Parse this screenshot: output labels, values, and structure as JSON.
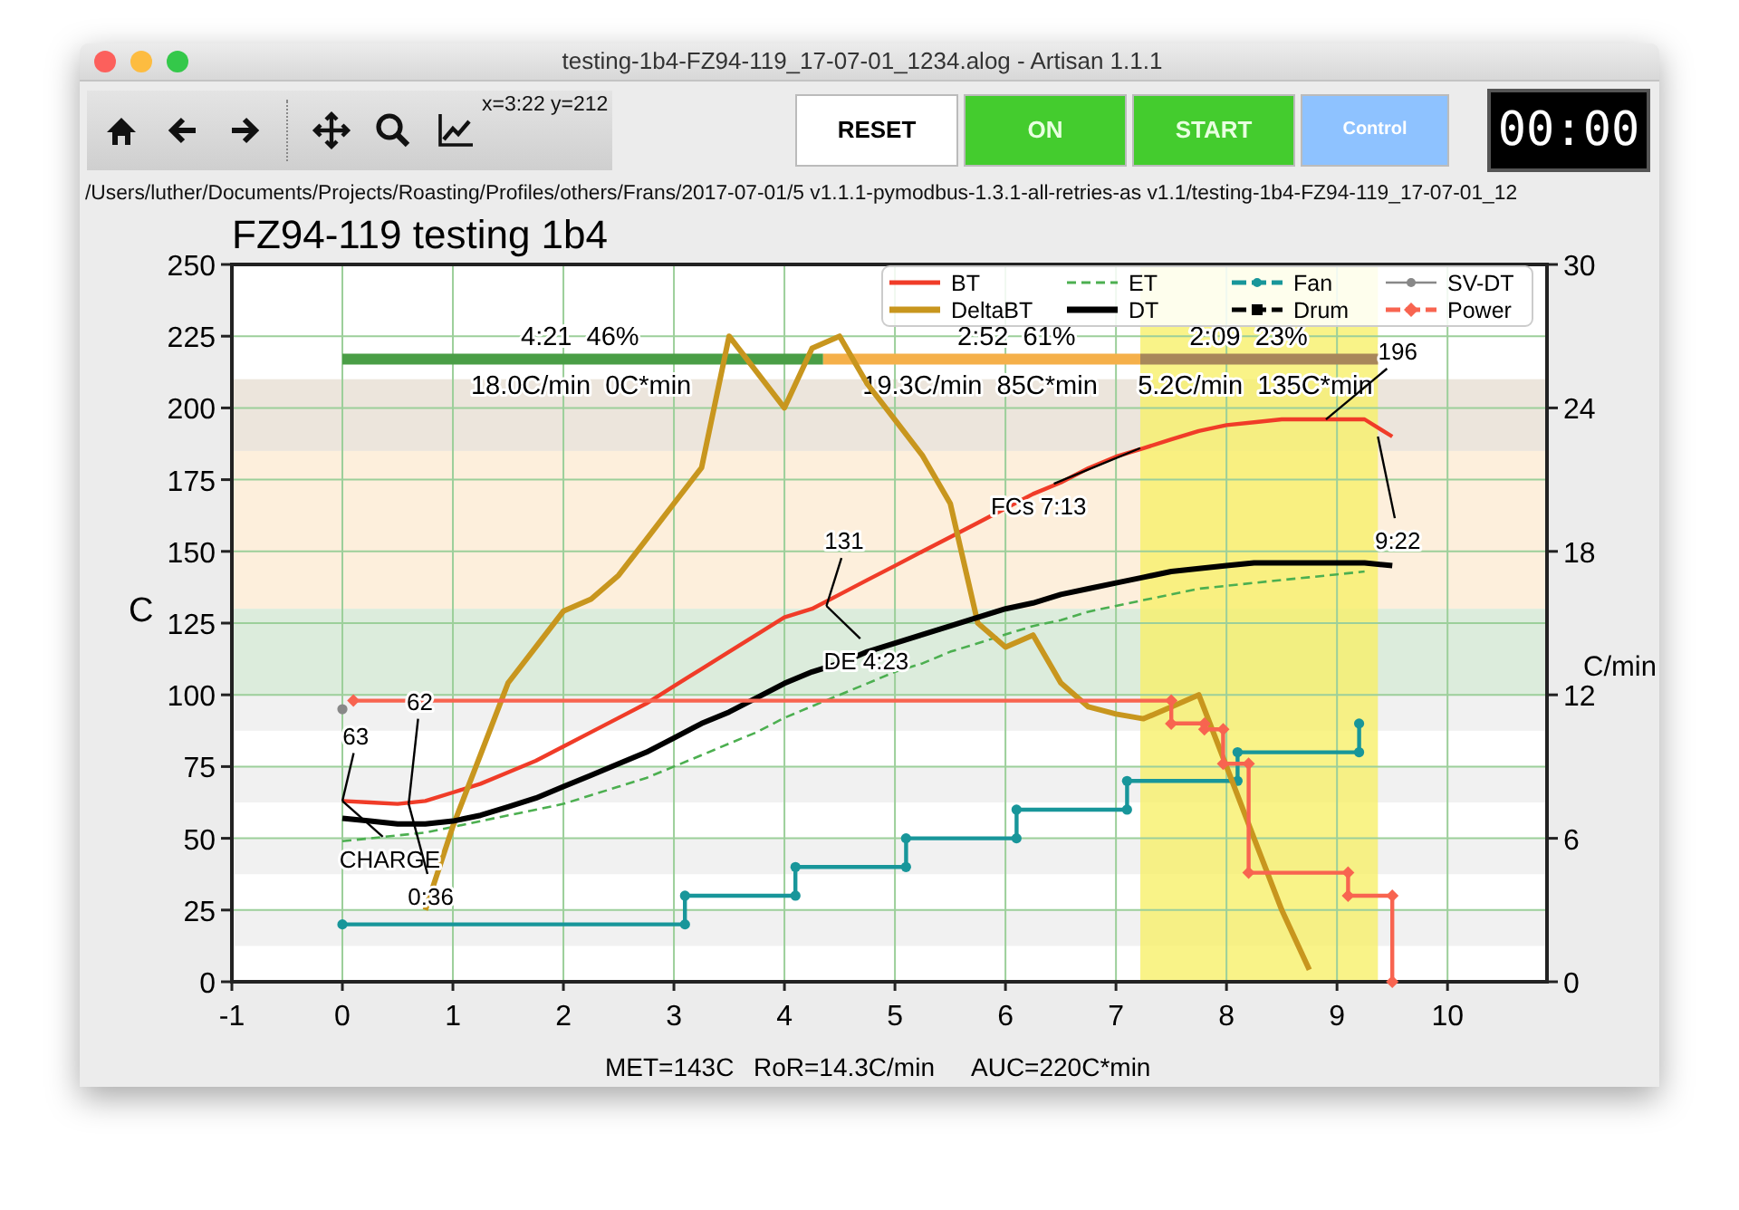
{
  "window": {
    "title": "testing-1b4-FZ94-119_17-07-01_1234.alog - Artisan 1.1.1"
  },
  "toolbar": {
    "coordinates": "x=3:22 y=212"
  },
  "buttons": [
    {
      "label": "RESET",
      "kind": "reset"
    },
    {
      "label": "ON",
      "kind": "on"
    },
    {
      "label": "START",
      "kind": "start"
    },
    {
      "label": "Control",
      "kind": "control"
    }
  ],
  "timer": "00:00",
  "file_path": "/Users/luther/Documents/Projects/Roasting/Profiles/others/Frans/2017-07-01/5 v1.1.1-pymodbus-1.3.1-all-retries-as v1.1/testing-1b4-FZ94-119_17-07-01_12",
  "chart": {
    "chart_data": {
      "type": "line",
      "title": "FZ94-119 testing 1b4",
      "ylabel": "C",
      "y2label": "C/min",
      "x": [
        0,
        0.25,
        0.5,
        0.75,
        1,
        1.25,
        1.5,
        1.75,
        2,
        2.25,
        2.5,
        2.75,
        3,
        3.25,
        3.5,
        3.75,
        4,
        4.25,
        4.5,
        4.75,
        5,
        5.25,
        5.5,
        5.75,
        6,
        6.25,
        6.5,
        6.75,
        7,
        7.25,
        7.5,
        7.75,
        8,
        8.25,
        8.5,
        8.75,
        9,
        9.25,
        9.5
      ],
      "xlim": [
        -1,
        10.9
      ],
      "ylim": [
        0,
        250
      ],
      "y2lim": [
        0,
        30
      ],
      "xticks": [
        -1,
        0,
        1,
        2,
        3,
        4,
        5,
        6,
        7,
        8,
        9,
        10
      ],
      "yticks": [
        0,
        25,
        50,
        75,
        100,
        125,
        150,
        175,
        200,
        225,
        250
      ],
      "y2ticks": [
        0,
        6,
        12,
        18,
        24,
        30
      ],
      "grid": true,
      "legend": true,
      "bands": [
        {
          "axis": "y",
          "from": 185,
          "to": 210,
          "color": "#ece5dc"
        },
        {
          "axis": "y",
          "from": 130,
          "to": 185,
          "color": "#fdefdc"
        },
        {
          "axis": "y",
          "from": 100,
          "to": 130,
          "color": "#dcecdc"
        },
        {
          "axis": "x",
          "from": 7.22,
          "to": 9.37,
          "color": "#f7f06a"
        }
      ],
      "series": [
        {
          "name": "BT",
          "color": "#f03c28",
          "values": [
            63,
            62.5,
            62,
            63,
            66,
            69,
            73,
            77,
            82,
            87,
            92,
            97,
            103,
            109,
            115,
            121,
            127,
            130,
            135,
            140,
            145,
            150,
            155,
            160,
            165,
            170,
            174,
            179,
            183,
            186,
            189,
            192,
            194,
            195,
            196,
            196,
            196,
            196,
            190
          ]
        },
        {
          "name": "ET",
          "color": "#4caf50",
          "line_style": "dashed",
          "values": [
            49,
            50,
            51,
            52,
            54,
            56,
            58,
            60,
            62,
            65,
            68,
            71,
            75,
            79,
            83,
            87,
            92,
            96,
            100,
            104,
            108,
            111,
            115,
            118,
            121,
            124,
            126,
            129,
            131,
            133,
            135,
            137,
            138,
            139,
            140,
            141,
            142,
            143,
            null
          ]
        },
        {
          "name": "Fan",
          "color": "#18969a",
          "marker": "circle",
          "x": [
            0,
            3.1,
            3.1,
            4.1,
            4.1,
            5.1,
            5.1,
            6.1,
            6.1,
            7.1,
            7.1,
            8.1,
            8.1,
            9.2,
            9.2
          ],
          "values": [
            20,
            20,
            30,
            30,
            40,
            40,
            50,
            50,
            60,
            60,
            70,
            70,
            80,
            80,
            90
          ]
        },
        {
          "name": "SV-DT",
          "color": "#888888",
          "marker": "circle",
          "values": [
            95,
            null,
            null,
            null,
            null,
            null,
            null,
            null,
            null,
            null,
            null,
            null,
            null,
            null,
            null,
            null,
            null,
            null,
            null,
            null,
            null,
            null,
            null,
            null,
            null,
            null,
            null,
            null,
            null,
            null,
            null,
            null,
            null,
            null,
            null,
            null,
            null,
            null,
            null
          ]
        },
        {
          "name": "DeltaBT",
          "color": "#c8961e",
          "axis": "y2",
          "values": [
            null,
            null,
            null,
            3,
            6.5,
            9.5,
            12.5,
            14,
            15.5,
            16,
            17,
            18.5,
            20,
            21.5,
            27,
            25.5,
            24,
            26.5,
            27,
            25,
            23.5,
            22,
            20,
            15,
            14,
            14.5,
            12.5,
            11.5,
            11.2,
            11,
            11.5,
            12,
            9,
            6,
            3,
            0.5,
            null,
            null,
            null
          ]
        },
        {
          "name": "DT",
          "color": "#000000",
          "values": [
            57,
            56,
            55,
            55,
            56,
            58,
            61,
            64,
            68,
            72,
            76,
            80,
            85,
            90,
            94,
            99,
            104,
            108,
            111,
            115,
            118,
            121,
            124,
            127,
            130,
            132,
            135,
            137,
            139,
            141,
            143,
            144,
            145,
            146,
            146,
            146,
            146,
            146,
            145
          ]
        },
        {
          "name": "Drum",
          "color": "#000000",
          "marker": "square",
          "values": [
            null,
            null,
            null,
            null,
            null,
            null,
            null,
            null,
            null,
            null,
            null,
            null,
            null,
            null,
            null,
            null,
            null,
            null,
            null,
            null,
            null,
            null,
            null,
            null,
            null,
            null,
            null,
            null,
            null,
            null,
            null,
            null,
            null,
            null,
            null,
            null,
            null,
            null,
            null
          ]
        },
        {
          "name": "Power",
          "color": "#f86450",
          "marker": "diamond",
          "x": [
            0.1,
            7.5,
            7.5,
            7.8,
            7.8,
            7.97,
            7.97,
            8.2,
            8.2,
            9.1,
            9.1,
            9.5,
            9.5
          ],
          "values": [
            98,
            98,
            90,
            90,
            88,
            88,
            76,
            76,
            38,
            38,
            30,
            30,
            0
          ]
        },
        {
          "color": "#4a9e46",
          "x": [
            0,
            4.35
          ],
          "values": [
            217,
            217
          ]
        },
        {
          "color": "#f5b04a",
          "x": [
            4.35,
            7.22
          ],
          "values": [
            217,
            217
          ]
        },
        {
          "color": "#a8875a",
          "x": [
            7.22,
            9.37
          ],
          "values": [
            217,
            217
          ]
        }
      ]
    },
    "phase_labels": [
      "4:21  46%",
      "2:52  61%",
      "2:09  23%",
      "18.0C/min  0C*min",
      "19.3C/min  85C*min",
      "5.2C/min  135C*min"
    ],
    "events": [
      "63",
      "62",
      "CHARGE",
      "0:36",
      "131",
      "DE 4:23",
      "FCs 7:13",
      "196",
      "9:22"
    ],
    "status": [
      "MET=143C",
      "RoR=14.3C/min",
      "AUC=220C*min"
    ]
  }
}
